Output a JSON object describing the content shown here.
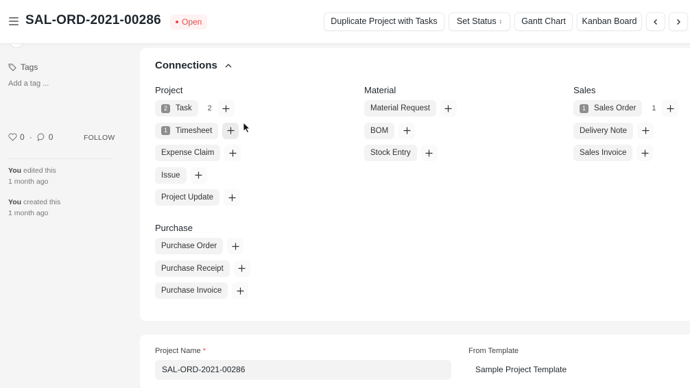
{
  "header": {
    "title": "SAL-ORD-2021-00286",
    "status": "Open",
    "status_color": "#e24c4c",
    "buttons": {
      "duplicate": "Duplicate Project with Tasks",
      "set_status": "Set Status",
      "gantt": "Gantt Chart",
      "kanban": "Kanban Board"
    }
  },
  "sidebar": {
    "tags_label": "Tags",
    "add_tag": "Add a tag ...",
    "likes": "0",
    "comments": "0",
    "follow": "FOLLOW",
    "activity": [
      {
        "who": "You",
        "action": "edited this",
        "when": "1 month ago"
      },
      {
        "who": "You",
        "action": "created this",
        "when": "1 month ago"
      }
    ]
  },
  "connections": {
    "title": "Connections",
    "groups": {
      "project": {
        "title": "Project",
        "items": [
          {
            "label": "Task",
            "badge": "2",
            "count": "2"
          },
          {
            "label": "Timesheet",
            "badge": "1"
          },
          {
            "label": "Expense Claim"
          },
          {
            "label": "Issue"
          },
          {
            "label": "Project Update"
          }
        ]
      },
      "purchase": {
        "title": "Purchase",
        "items": [
          {
            "label": "Purchase Order"
          },
          {
            "label": "Purchase Receipt"
          },
          {
            "label": "Purchase Invoice"
          }
        ]
      },
      "material": {
        "title": "Material",
        "items": [
          {
            "label": "Material Request"
          },
          {
            "label": "BOM"
          },
          {
            "label": "Stock Entry"
          }
        ]
      },
      "sales": {
        "title": "Sales",
        "items": [
          {
            "label": "Sales Order",
            "badge": "1",
            "count": "1"
          },
          {
            "label": "Delivery Note"
          },
          {
            "label": "Sales Invoice"
          }
        ]
      }
    }
  },
  "form": {
    "project_name_label": "Project Name",
    "required_mark": "*",
    "project_name_value": "SAL-ORD-2021-00286",
    "from_template_label": "From Template",
    "from_template_value": "Sample Project Template"
  }
}
